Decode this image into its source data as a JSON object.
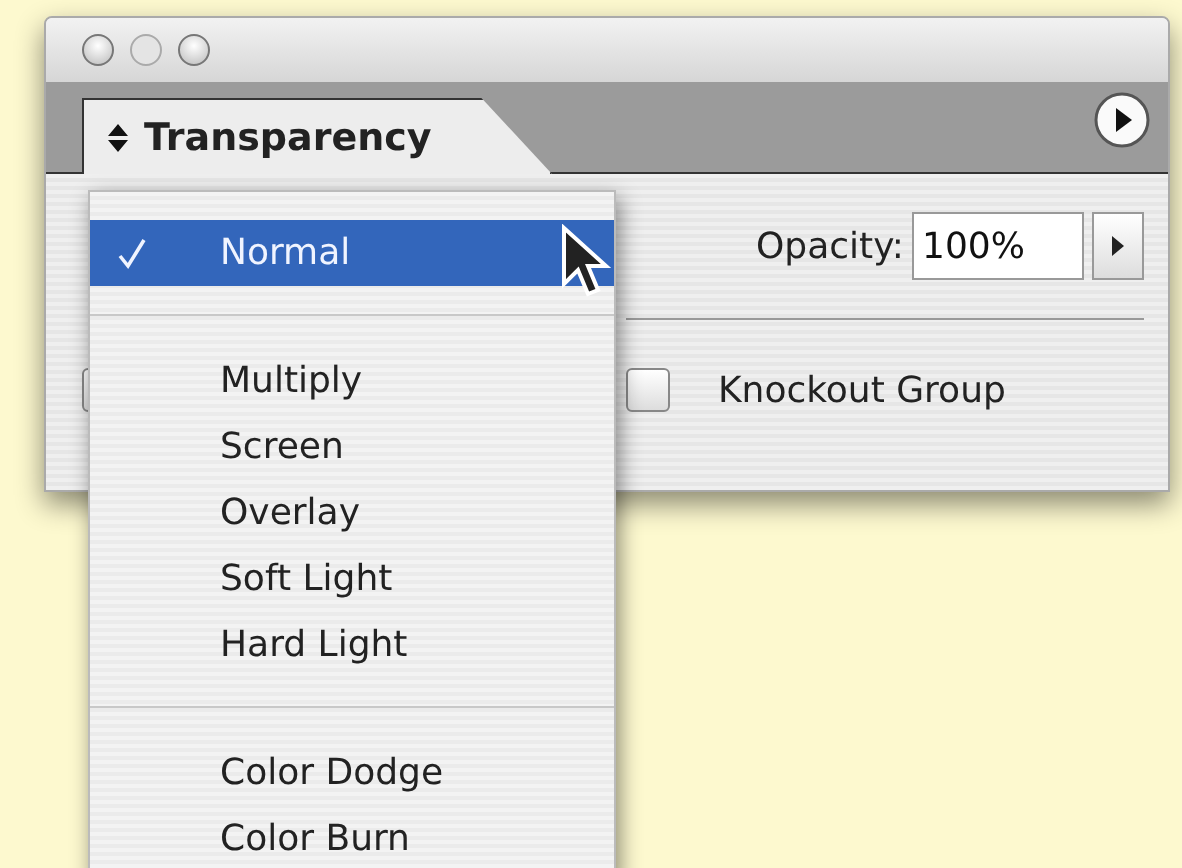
{
  "panel": {
    "tab": {
      "label": "Transparency"
    },
    "opacity": {
      "label": "Opacity:",
      "value": "100%"
    },
    "checkboxes": [
      {
        "checked": false
      },
      {
        "label": "Knockout Group",
        "checked": false
      }
    ]
  },
  "blend_menu": {
    "items": [
      {
        "kind": "item",
        "label": "Normal",
        "selected": true
      },
      {
        "kind": "separator"
      },
      {
        "kind": "item",
        "label": "Multiply",
        "selected": false
      },
      {
        "kind": "item",
        "label": "Screen",
        "selected": false
      },
      {
        "kind": "item",
        "label": "Overlay",
        "selected": false
      },
      {
        "kind": "item",
        "label": "Soft Light",
        "selected": false
      },
      {
        "kind": "item",
        "label": "Hard Light",
        "selected": false
      },
      {
        "kind": "separator"
      },
      {
        "kind": "item",
        "label": "Color Dodge",
        "selected": false
      },
      {
        "kind": "item",
        "label": "Color Burn",
        "selected": false
      }
    ]
  }
}
